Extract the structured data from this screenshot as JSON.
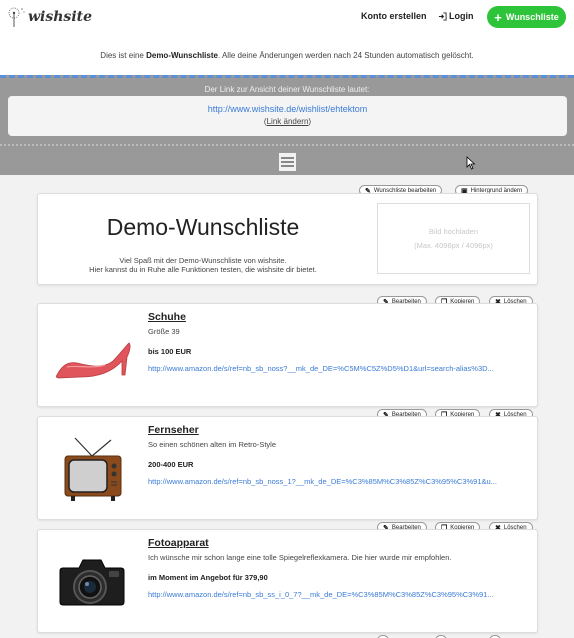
{
  "header": {
    "logo_text": "wishsite",
    "konto_erstellen": "Konto erstellen",
    "login": "Login",
    "wunschliste_button": "Wunschliste",
    "accent": "#2ec43a"
  },
  "notice": {
    "prefix": "Dies ist eine ",
    "bold": "Demo-Wunschliste",
    "suffix": ". Alle deine Änderungen werden nach 24 Stunden automatisch gelöscht."
  },
  "link_section": {
    "label": "Der Link zur Ansicht deiner Wunschliste lautet:",
    "url": "http://www.wishsite.de/wishlist/ehtektom",
    "change_open": "(",
    "change_text": "Link ändern",
    "change_close": ")"
  },
  "wishlist": {
    "edit_button": "Wunschliste bearbeiten",
    "background_button": "Hintergrund ändern",
    "title": "Demo-Wunschliste",
    "desc_line1": "Viel Spaß mit der Demo-Wunschliste von wishsite.",
    "desc_line2": "Hier kannst du in Ruhe alle Funktionen testen, die wishsite dir bietet.",
    "image_upload": "Bild hochladen",
    "image_hint": "(Max. 4096px / 4096px)"
  },
  "item_actions": {
    "edit": "Bearbeiten",
    "copy": "Kopieren",
    "delete": "Löschen"
  },
  "items": [
    {
      "name": "Schuhe",
      "desc": "Größe 39",
      "price": "bis 100 EUR",
      "link": "http://www.amazon.de/s/ref=nb_sb_noss?__mk_de_DE=%C5M%C5Z%D5%D1&url=search-alias%3D...",
      "icon": "high-heel-shoe"
    },
    {
      "name": "Fernseher",
      "desc": "So einen schönen alten im Retro-Style",
      "price": "200-400 EUR",
      "link": "http://www.amazon.de/s/ref=nb_sb_noss_1?__mk_de_DE=%C3%85M%C3%85Z%C3%95%C3%91&u...",
      "icon": "retro-tv"
    },
    {
      "name": "Fotoapparat",
      "desc": "Ich wünsche mir schon lange eine tolle Spiegelreflexkamera. Die hier wurde mir empfohlen.",
      "price": "im Moment im Angebot für 379,90",
      "link": "http://www.amazon.de/s/ref=nb_sb_ss_i_0_7?__mk_de_DE=%C3%85M%C3%85Z%C3%95%C3%91...",
      "icon": "dslr-camera"
    }
  ]
}
